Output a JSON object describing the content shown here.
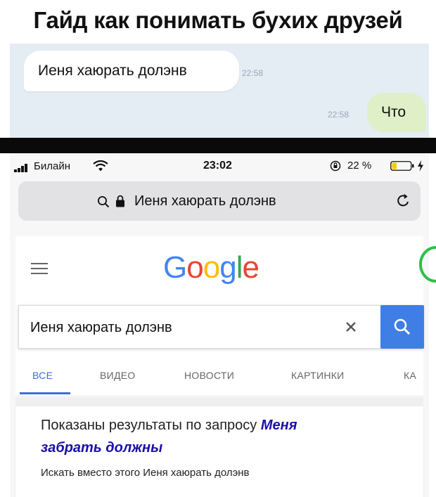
{
  "meme": {
    "title": "Гайд как понимать бухих друзей"
  },
  "chat": {
    "incoming_message": "Иеня хаюрать долэнв",
    "incoming_time": "22:58",
    "outgoing_message": "Что",
    "outgoing_time": "22:58"
  },
  "status_bar": {
    "carrier": "Билайн",
    "time": "23:02",
    "battery": "22 %"
  },
  "browser": {
    "url_text": "Иеня хаюрать долэнв"
  },
  "google": {
    "logo_letters": [
      "G",
      "o",
      "o",
      "g",
      "l",
      "e"
    ],
    "logo_colors": [
      "#4285F4",
      "#EA4335",
      "#FBBC05",
      "#4285F4",
      "#34A853",
      "#EA4335"
    ],
    "search_value": "Иеня хаюрать долэнв",
    "tabs": [
      "ВСЕ",
      "ВИДЕО",
      "НОВОСТИ",
      "КАРТИНКИ",
      "КА"
    ],
    "active_tab": "ВСЕ",
    "accent_color": "#3f7fe5"
  },
  "results": {
    "shown_prefix": "Показаны результаты по запросу",
    "corrected_query_part1": "Меня",
    "corrected_query_part2": "забрать должны",
    "instead_prefix": "Искать вместо этого",
    "instead_query": "Иеня хаюрать долэнв"
  }
}
